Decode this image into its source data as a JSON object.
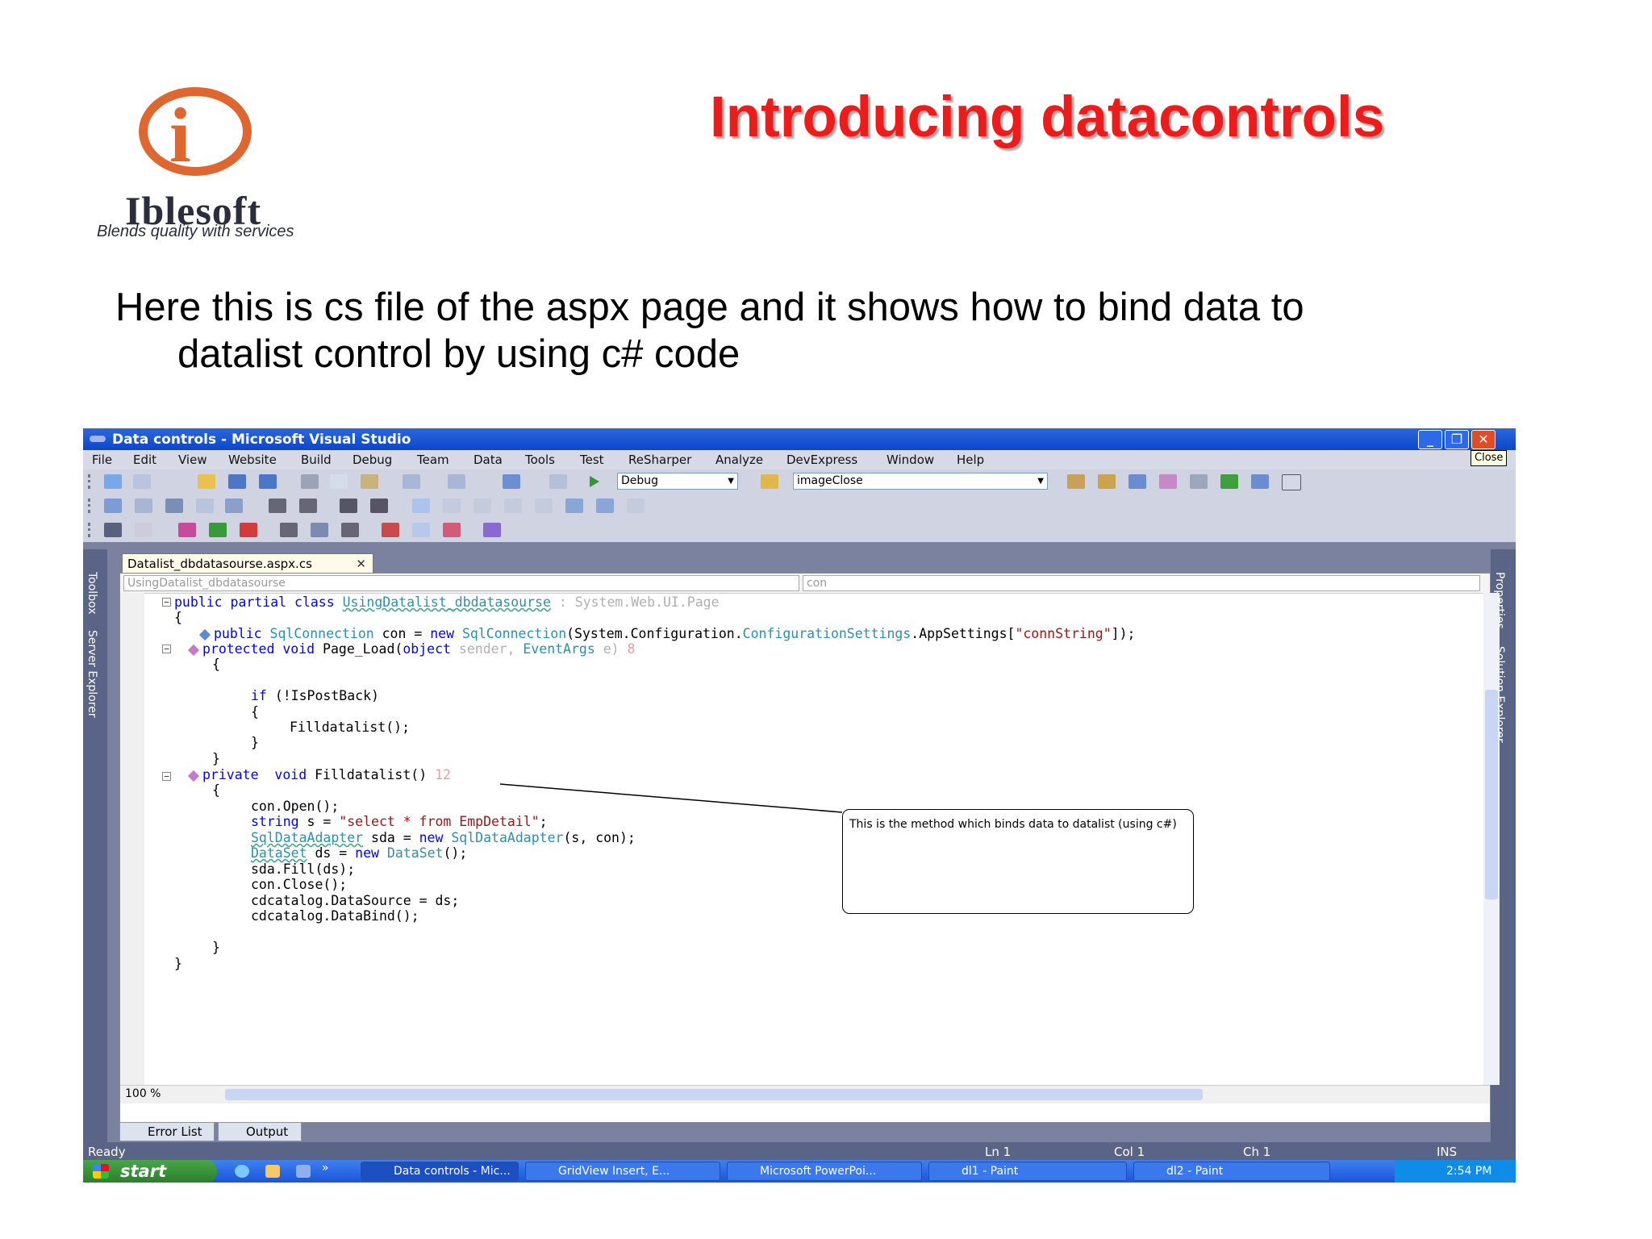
{
  "slide": {
    "logo_letter": "i",
    "logo_name": "Iblesoft",
    "logo_tagline": "Blends quality with services",
    "title": "Introducing datacontrols",
    "text_line1": "Here this is cs file of the aspx page and it shows how to bind data to",
    "text_line2": "datalist control by using c#  code"
  },
  "window": {
    "title": "Data controls - Microsoft Visual Studio",
    "minimize": "_",
    "maximize": "❐",
    "close": "✕",
    "close_tooltip": "Close"
  },
  "menu": [
    "File",
    "Edit",
    "View",
    "Website",
    "Build",
    "Debug",
    "Team",
    "Data",
    "Tools",
    "Test",
    "ReSharper",
    "Analyze",
    "DevExpress",
    "Window",
    "Help"
  ],
  "toolbar": {
    "config_dropdown": "Debug",
    "find_dropdown": "imageClose"
  },
  "side_tabs": {
    "left": [
      "Toolbox",
      "Server Explorer"
    ],
    "right": [
      "Properties",
      "Solution Explorer"
    ]
  },
  "document": {
    "tab_label": "Datalist_dbdatasourse.aspx.cs",
    "tab_close": "✕",
    "class_dropdown": "UsingDatalist_dbdatasourse",
    "member_dropdown": "con",
    "zoom": "100 %"
  },
  "code": {
    "l1_kw": "public partial class ",
    "l1_cls": "UsingDatalist_dbdatasourse",
    "l1_rest": " : System.Web.UI.Page",
    "l2": "{",
    "l3_kw": "public ",
    "l3_ty": "SqlConnection",
    "l3_a": " con = ",
    "l3_kw2": "new ",
    "l3_ty2": "SqlConnection",
    "l3_b": "(System.Configuration.",
    "l3_ty3": "ConfigurationSettings",
    "l3_c": ".AppSettings[",
    "l3_st": "\"connString\"",
    "l3_d": "]);",
    "l4_kw": "protected void ",
    "l4_a": "Page_Load(",
    "l4_kw2": "object ",
    "l4_b": "sender, ",
    "l4_ty": "EventArgs",
    "l4_c": " e)",
    "l4_ref": " 8",
    "l5": "{",
    "l6_kw": "if ",
    "l6_a": "(!IsPostBack)",
    "l7": "{",
    "l8": "Filldatalist();",
    "l9": "}",
    "l10": "}",
    "l11_kw": "private  void ",
    "l11_a": "Filldatalist()",
    "l11_ref": " 12",
    "l12": "{",
    "l13": "con.Open();",
    "l14_kw": "string ",
    "l14_a": "s = ",
    "l14_st": "\"select * from EmpDetail\"",
    "l14_b": ";",
    "l15_ty": "SqlDataAdapter",
    "l15_a": " sda = ",
    "l15_kw": "new ",
    "l15_ty2": "SqlDataAdapter",
    "l15_b": "(s, con);",
    "l16_ty": "DataSet",
    "l16_a": " ds = ",
    "l16_kw": "new ",
    "l16_ty2": "DataSet",
    "l16_b": "();",
    "l17": "sda.Fill(ds);",
    "l18": "con.Close();",
    "l19": "cdcatalog.DataSource = ds;",
    "l20": "cdcatalog.DataBind();",
    "l21": "}",
    "l22": "}"
  },
  "callout": "This is the method which binds data to datalist (using c#)",
  "bottom_tabs": [
    "Error List",
    "Output"
  ],
  "status": {
    "state": "Ready",
    "ln": "Ln 1",
    "col": "Col 1",
    "ch": "Ch 1",
    "mode": "INS"
  },
  "taskbar": {
    "start": "start",
    "expand": "»",
    "tasks": [
      "Data controls - Mic...",
      "GridView Insert, E...",
      "Microsoft PowerPoi...",
      "dl1 - Paint",
      "dl2 - Paint"
    ],
    "clock": "2:54 PM"
  },
  "colors": {
    "title_red": "#ee1b1b",
    "logo_orange": "#e0662f",
    "xp_blue": "#0b47c9",
    "vs_rail": "#5a6486"
  }
}
